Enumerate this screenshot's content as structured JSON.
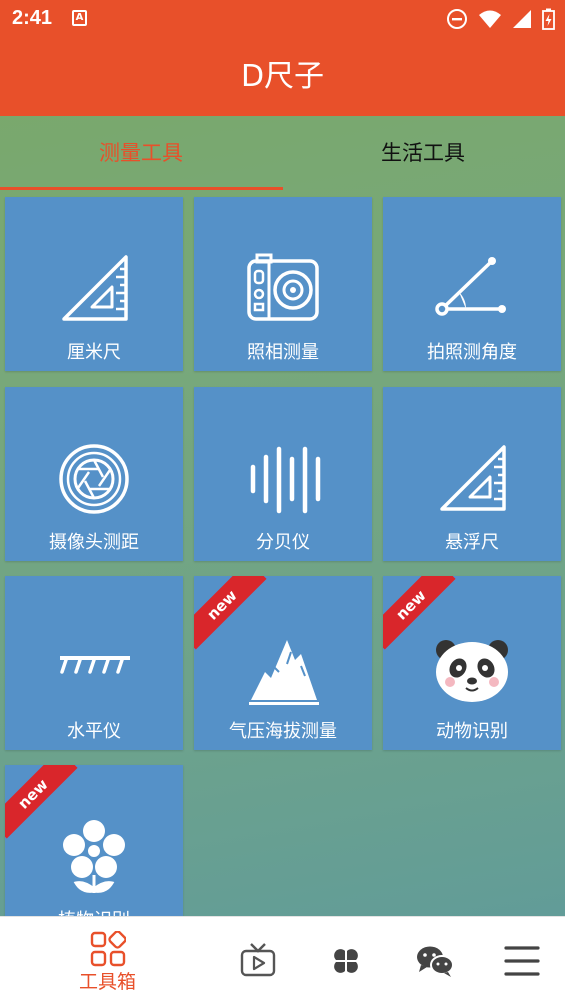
{
  "status_bar": {
    "time": "2:41",
    "notification_letter": "A"
  },
  "app_bar": {
    "title": "D尺子"
  },
  "tabs": [
    {
      "label": "测量工具",
      "selected": true
    },
    {
      "label": "生活工具",
      "selected": false
    }
  ],
  "tiles": [
    {
      "label": "厘米尺",
      "icon": "set-square-ruler-icon",
      "badge": ""
    },
    {
      "label": "照相测量",
      "icon": "camera-icon",
      "badge": ""
    },
    {
      "label": "拍照测角度",
      "icon": "angle-icon",
      "badge": ""
    },
    {
      "label": "摄像头测距",
      "icon": "camera-aperture-icon",
      "badge": ""
    },
    {
      "label": "分贝仪",
      "icon": "sound-bars-icon",
      "badge": ""
    },
    {
      "label": "悬浮尺",
      "icon": "set-square-ruler-icon",
      "badge": ""
    },
    {
      "label": "水平仪",
      "icon": "level-ruler-icon",
      "badge": ""
    },
    {
      "label": "气压海拔测量",
      "icon": "mountain-icon",
      "badge": "new"
    },
    {
      "label": "动物识别",
      "icon": "panda-icon",
      "badge": "new"
    },
    {
      "label": "植物识别",
      "icon": "flower-icon",
      "badge": "new"
    }
  ],
  "bottom_nav": [
    {
      "label": "工具箱",
      "icon": "toolbox-grid-icon",
      "selected": true
    },
    {
      "label": "",
      "icon": "tv-play-icon",
      "selected": false
    },
    {
      "label": "",
      "icon": "clover-icon",
      "selected": false
    },
    {
      "label": "",
      "icon": "wechat-icon",
      "selected": false
    },
    {
      "label": "",
      "icon": "menu-icon",
      "selected": false
    }
  ],
  "colors": {
    "accent": "#e8502a",
    "tile": "#5591c8",
    "ribbon": "#d9262b"
  }
}
